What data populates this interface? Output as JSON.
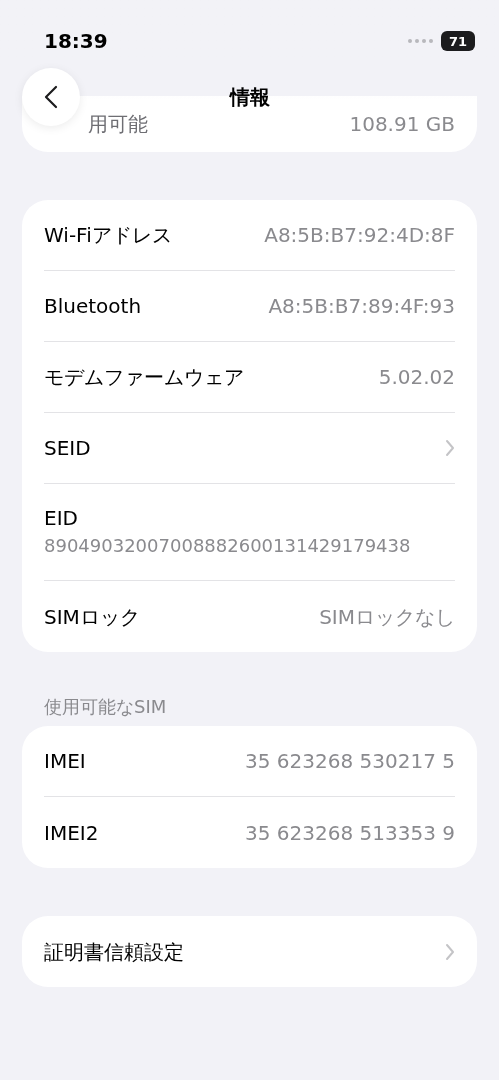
{
  "status_bar": {
    "time": "18:39",
    "battery": "71"
  },
  "nav": {
    "title": "情報"
  },
  "storage_row": {
    "label": "用可能",
    "value": "108.91 GB"
  },
  "sections": [
    {
      "rows": [
        {
          "kind": "value",
          "label": "Wi-Fiアドレス",
          "value": "A8:5B:B7:92:4D:8F"
        },
        {
          "kind": "value",
          "label": "Bluetooth",
          "value": "A8:5B:B7:89:4F:93"
        },
        {
          "kind": "value",
          "label": "モデムファームウェア",
          "value": "5.02.02"
        },
        {
          "kind": "chevron",
          "label": "SEID"
        },
        {
          "kind": "stacked",
          "label": "EID",
          "value": "89049032007008882600131429179438"
        },
        {
          "kind": "value",
          "label": "SIMロック",
          "value": "SIMロックなし"
        }
      ]
    },
    {
      "header": "使用可能なSIM",
      "rows": [
        {
          "kind": "value",
          "label": "IMEI",
          "value": "35 623268 530217 5"
        },
        {
          "kind": "value",
          "label": "IMEI2",
          "value": "35 623268 513353 9"
        }
      ]
    },
    {
      "rows": [
        {
          "kind": "chevron",
          "label": "証明書信頼設定"
        }
      ]
    }
  ]
}
